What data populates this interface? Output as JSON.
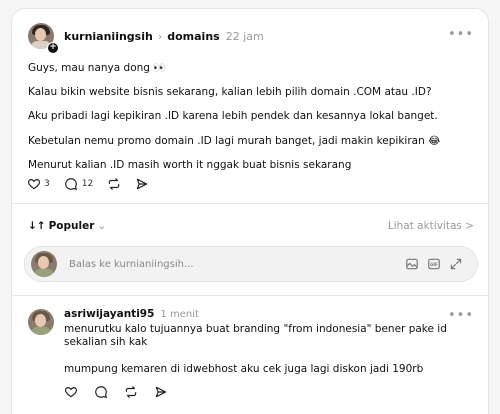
{
  "post": {
    "username": "kurnianiingsih",
    "topic": "domains",
    "time": "22 jam",
    "paragraphs": [
      "Guys, mau nanya dong 👀",
      "Kalau bikin website bisnis sekarang, kalian lebih pilih domain .COM atau .ID?",
      "Aku pribadi lagi kepikiran .ID karena lebih pendek dan kesannya lokal banget.",
      "Kebetulan nemu promo domain .ID lagi murah banget, jadi makin kepikiran 😂",
      "Menurut kalian .ID masih worth it nggak buat bisnis sekarang"
    ],
    "likes": "3",
    "comments": "12"
  },
  "sort": {
    "label": "Populer",
    "activity_link": "Lihat aktivitas >"
  },
  "reply": {
    "placeholder": "Balas ke kurnianiingsih..."
  },
  "comment": {
    "username": "asriwijayanti95",
    "time": "1 menit",
    "lines": [
      "menurutku kalo tujuannya buat branding \"from indonesia\" bener pake id",
      "sekalian sih kak"
    ],
    "paragraph2": "mumpung kemaren di idwebhost aku cek juga lagi diskon jadi 190rb"
  },
  "icons": {
    "like": "heart-icon",
    "comment": "comment-icon",
    "repost": "repost-icon",
    "share": "share-icon",
    "more": "more-icon",
    "sort": "sort-icon",
    "gif": "gif-icon",
    "image": "image-icon",
    "expand": "expand-icon"
  }
}
